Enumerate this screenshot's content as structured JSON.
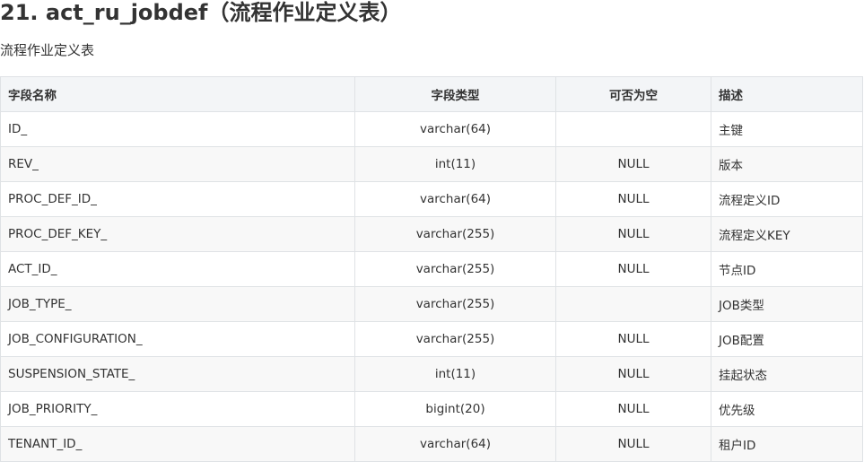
{
  "heading": {
    "title": "21. act_ru_jobdef（流程作业定义表）",
    "description": "流程作业定义表"
  },
  "table": {
    "headers": {
      "name": "字段名称",
      "type": "字段类型",
      "nullable": "可否为空",
      "desc": "描述"
    },
    "rows": [
      {
        "name": "ID_",
        "type": "varchar(64)",
        "nullable": "",
        "desc": "主键"
      },
      {
        "name": "REV_",
        "type": "int(11)",
        "nullable": "NULL",
        "desc": "版本"
      },
      {
        "name": "PROC_DEF_ID_",
        "type": "varchar(64)",
        "nullable": "NULL",
        "desc": "流程定义ID"
      },
      {
        "name": "PROC_DEF_KEY_",
        "type": "varchar(255)",
        "nullable": "NULL",
        "desc": "流程定义KEY"
      },
      {
        "name": "ACT_ID_",
        "type": "varchar(255)",
        "nullable": "NULL",
        "desc": "节点ID"
      },
      {
        "name": "JOB_TYPE_",
        "type": "varchar(255)",
        "nullable": "",
        "desc": "JOB类型"
      },
      {
        "name": "JOB_CONFIGURATION_",
        "type": "varchar(255)",
        "nullable": "NULL",
        "desc": "JOB配置"
      },
      {
        "name": "SUSPENSION_STATE_",
        "type": "int(11)",
        "nullable": "NULL",
        "desc": "挂起状态"
      },
      {
        "name": "JOB_PRIORITY_",
        "type": "bigint(20)",
        "nullable": "NULL",
        "desc": "优先级"
      },
      {
        "name": "TENANT_ID_",
        "type": "varchar(64)",
        "nullable": "NULL",
        "desc": "租户ID"
      }
    ]
  }
}
